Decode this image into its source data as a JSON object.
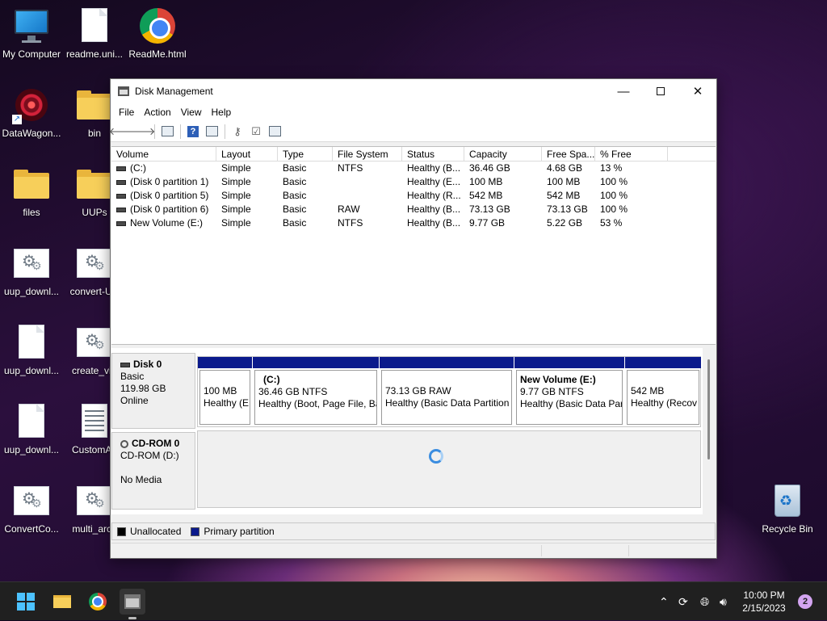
{
  "desktop": {
    "icons": [
      {
        "label": "My Computer",
        "icon": "monitor-icon"
      },
      {
        "label": "readme.uni...",
        "icon": "document-icon"
      },
      {
        "label": "ReadMe.html",
        "icon": "chrome-icon"
      },
      {
        "label": "DataWagon...",
        "icon": "shortcut-icon"
      },
      {
        "label": "bin",
        "icon": "folder-icon"
      },
      {
        "label": "files",
        "icon": "folder-icon"
      },
      {
        "label": "UUPs",
        "icon": "folder-icon"
      },
      {
        "label": "uup_downl...",
        "icon": "settings-file-icon"
      },
      {
        "label": "convert-UU",
        "icon": "settings-file-icon"
      },
      {
        "label": "uup_downl...",
        "icon": "document-icon"
      },
      {
        "label": "create_virt",
        "icon": "settings-file-icon"
      },
      {
        "label": "uup_downl...",
        "icon": "document-icon"
      },
      {
        "label": "CustomAp",
        "icon": "text-file-icon"
      },
      {
        "label": "ConvertCo...",
        "icon": "settings-file-icon"
      },
      {
        "label": "multi_arch",
        "icon": "settings-file-icon"
      },
      {
        "label": "Recycle Bin",
        "icon": "recycle-bin-icon"
      }
    ]
  },
  "window": {
    "title": "Disk Management",
    "menu": [
      "File",
      "Action",
      "View",
      "Help"
    ],
    "columns": [
      "Volume",
      "Layout",
      "Type",
      "File System",
      "Status",
      "Capacity",
      "Free Spa...",
      "% Free"
    ],
    "volumes": [
      {
        "volume": "(C:)",
        "layout": "Simple",
        "type": "Basic",
        "fs": "NTFS",
        "status": "Healthy (B...",
        "capacity": "36.46 GB",
        "free": "4.68 GB",
        "pct": "13 %"
      },
      {
        "volume": "(Disk 0 partition 1)",
        "layout": "Simple",
        "type": "Basic",
        "fs": "",
        "status": "Healthy (E...",
        "capacity": "100 MB",
        "free": "100 MB",
        "pct": "100 %"
      },
      {
        "volume": "(Disk 0 partition 5)",
        "layout": "Simple",
        "type": "Basic",
        "fs": "",
        "status": "Healthy (R...",
        "capacity": "542 MB",
        "free": "542 MB",
        "pct": "100 %"
      },
      {
        "volume": "(Disk 0 partition 6)",
        "layout": "Simple",
        "type": "Basic",
        "fs": "RAW",
        "status": "Healthy (B...",
        "capacity": "73.13 GB",
        "free": "73.13 GB",
        "pct": "100 %"
      },
      {
        "volume": "New Volume (E:)",
        "layout": "Simple",
        "type": "Basic",
        "fs": "NTFS",
        "status": "Healthy (B...",
        "capacity": "9.77 GB",
        "free": "5.22 GB",
        "pct": "53 %"
      }
    ],
    "disk0": {
      "name": "Disk 0",
      "type": "Basic",
      "size": "119.98 GB",
      "state": "Online",
      "partitions": [
        {
          "name": "",
          "size": "100 MB",
          "status": "Healthy (E"
        },
        {
          "name": "(C:)",
          "size": "36.46 GB NTFS",
          "status": "Healthy (Boot, Page File, Ba"
        },
        {
          "name": "",
          "size": "73.13 GB RAW",
          "status": "Healthy (Basic Data Partition"
        },
        {
          "name": "New Volume  (E:)",
          "size": "9.77 GB NTFS",
          "status": "Healthy (Basic Data Par"
        },
        {
          "name": "",
          "size": "542 MB",
          "status": "Healthy (Recov"
        }
      ]
    },
    "cdrom": {
      "name": "CD-ROM 0",
      "drive": "CD-ROM (D:)",
      "media": "No Media"
    },
    "legend": {
      "unallocated": "Unallocated",
      "primary": "Primary partition"
    }
  },
  "taskbar": {
    "time": "10:00 PM",
    "date": "2/15/2023",
    "notifications": "2"
  },
  "colors": {
    "primary_partition": "#0b1a8c",
    "accent": "#4cc2ff"
  }
}
